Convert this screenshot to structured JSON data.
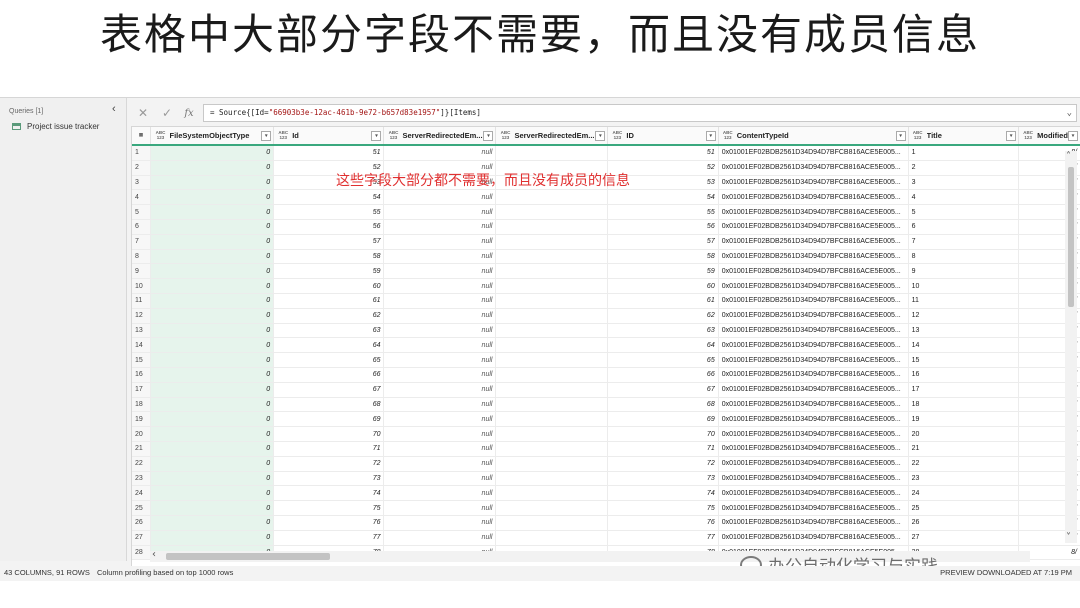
{
  "slide": {
    "title": "表格中大部分字段不需要，而且没有成员信息"
  },
  "queries": {
    "header": "Queries [1]",
    "items": [
      {
        "label": "Project issue tracker"
      }
    ]
  },
  "formula_bar": {
    "cancel_glyph": "✕",
    "confirm_glyph": "✓",
    "fx_label": "fx",
    "prefix": "= Source{[Id=",
    "id_literal": "\"66903b3e-12ac-461b-9e72-b657d83e1957\"",
    "suffix": "]}[Items]",
    "expand_glyph": "⌄"
  },
  "grid": {
    "columns": [
      {
        "type": "ABC\n123",
        "name": "FileSystemObjectType"
      },
      {
        "type": "ABC\n123",
        "name": "Id"
      },
      {
        "type": "ABC\n123",
        "name": "ServerRedirectedEm..."
      },
      {
        "type": "ABC\n123",
        "name": "ServerRedirectedEm..."
      },
      {
        "type": "ABC\n123",
        "name": "ID"
      },
      {
        "type": "ABC\n123",
        "name": "ContentTypeId"
      },
      {
        "type": "ABC\n123",
        "name": "Title"
      },
      {
        "type": "ABC\n123",
        "name": "Modified"
      }
    ],
    "content_type_prefix": "0x01001EF02BDB2561D34D94D7BFCB816ACE5E005...",
    "modified_value": "8/",
    "null_value": "null",
    "fs_value": "0",
    "rows": [
      {
        "n": "1",
        "id": "51",
        "title": "1"
      },
      {
        "n": "2",
        "id": "52",
        "title": "2"
      },
      {
        "n": "3",
        "id": "53",
        "title": "3"
      },
      {
        "n": "4",
        "id": "54",
        "title": "4"
      },
      {
        "n": "5",
        "id": "55",
        "title": "5"
      },
      {
        "n": "6",
        "id": "56",
        "title": "6"
      },
      {
        "n": "7",
        "id": "57",
        "title": "7"
      },
      {
        "n": "8",
        "id": "58",
        "title": "8"
      },
      {
        "n": "9",
        "id": "59",
        "title": "9"
      },
      {
        "n": "10",
        "id": "60",
        "title": "10"
      },
      {
        "n": "11",
        "id": "61",
        "title": "11"
      },
      {
        "n": "12",
        "id": "62",
        "title": "12"
      },
      {
        "n": "13",
        "id": "63",
        "title": "13"
      },
      {
        "n": "14",
        "id": "64",
        "title": "14"
      },
      {
        "n": "15",
        "id": "65",
        "title": "15"
      },
      {
        "n": "16",
        "id": "66",
        "title": "16"
      },
      {
        "n": "17",
        "id": "67",
        "title": "17"
      },
      {
        "n": "18",
        "id": "68",
        "title": "18"
      },
      {
        "n": "19",
        "id": "69",
        "title": "19"
      },
      {
        "n": "20",
        "id": "70",
        "title": "20"
      },
      {
        "n": "21",
        "id": "71",
        "title": "21"
      },
      {
        "n": "22",
        "id": "72",
        "title": "22"
      },
      {
        "n": "23",
        "id": "73",
        "title": "23"
      },
      {
        "n": "24",
        "id": "74",
        "title": "24"
      },
      {
        "n": "25",
        "id": "75",
        "title": "25"
      },
      {
        "n": "26",
        "id": "76",
        "title": "26"
      },
      {
        "n": "27",
        "id": "77",
        "title": "27"
      },
      {
        "n": "28",
        "id": "78",
        "title": "28"
      }
    ]
  },
  "annotation": {
    "text": "这些字段大部分都不需要，而且没有成员的信息"
  },
  "status": {
    "columns_rows": "43 COLUMNS, 91 ROWS",
    "profiling": "Column profiling based on top 1000 rows",
    "preview": "PREVIEW DOWNLOADED AT 7:19 PM"
  },
  "watermark": {
    "text": "办公自动化学习与实践"
  },
  "colors": {
    "accent": "#3aa87e",
    "annotation": "#e03030",
    "selected_col": "#e6f4ec"
  }
}
